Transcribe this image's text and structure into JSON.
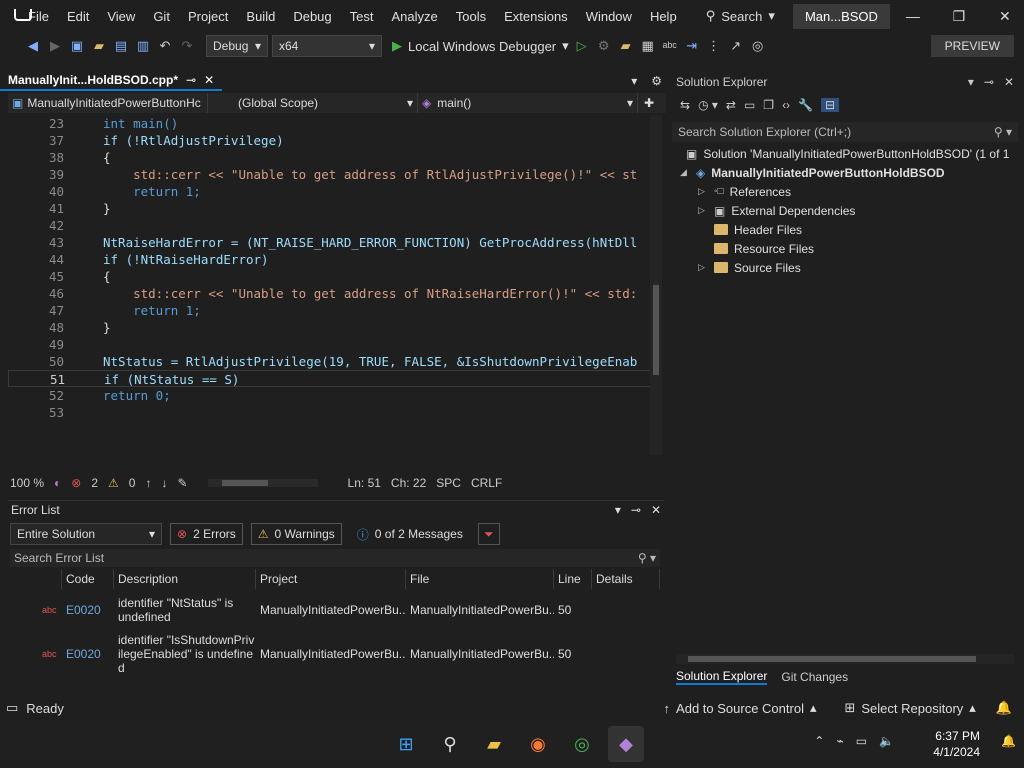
{
  "menu": {
    "items": [
      "File",
      "Edit",
      "View",
      "Git",
      "Project",
      "Build",
      "Debug",
      "Test",
      "Analyze",
      "Tools",
      "Extensions",
      "Window",
      "Help"
    ],
    "search_label": "Search",
    "project_short": "Man...BSOD"
  },
  "toolbar": {
    "config": "Debug",
    "platform": "x64",
    "run_label": "Local Windows Debugger",
    "preview_label": "PREVIEW"
  },
  "editor": {
    "tab_title": "ManuallyInit...HoldBSOD.cpp*",
    "nav_file": "ManuallyInitiatedPowerButtonHc",
    "nav_scope": "(Global Scope)",
    "nav_func": "main()",
    "lines": [
      {
        "n": "23",
        "text": "int main()"
      },
      {
        "n": "37",
        "text": "if (!RtlAdjustPrivilege)"
      },
      {
        "n": "38",
        "text": "{"
      },
      {
        "n": "39",
        "text": "    std::cerr << \"Unable to get address of RtlAdjustPrivilege()!\" << st"
      },
      {
        "n": "40",
        "text": "    return 1;"
      },
      {
        "n": "41",
        "text": "}"
      },
      {
        "n": "42",
        "text": ""
      },
      {
        "n": "43",
        "text": "NtRaiseHardError = (NT_RAISE_HARD_ERROR_FUNCTION) GetProcAddress(hNtDll"
      },
      {
        "n": "44",
        "text": "if (!NtRaiseHardError)"
      },
      {
        "n": "45",
        "text": "{"
      },
      {
        "n": "46",
        "text": "    std::cerr << \"Unable to get address of NtRaiseHardError()!\" << std:"
      },
      {
        "n": "47",
        "text": "    return 1;"
      },
      {
        "n": "48",
        "text": "}"
      },
      {
        "n": "49",
        "text": ""
      },
      {
        "n": "50",
        "text": "NtStatus = RtlAdjustPrivilege(19, TRUE, FALSE, &IsShutdownPrivilegeEnab"
      },
      {
        "n": "51",
        "text": "if (NtStatus == S)"
      },
      {
        "n": "52",
        "text": "return 0;"
      },
      {
        "n": "53",
        "text": ""
      }
    ],
    "zoom": "100 %",
    "errors_count": "2",
    "warnings_count": "0",
    "line_col": "Ln: 51",
    "ch": "Ch: 22",
    "spc": "SPC",
    "crlf": "CRLF"
  },
  "error_list": {
    "title": "Error List",
    "scope": "Entire Solution",
    "errors_btn": "2 Errors",
    "warnings_btn": "0 Warnings",
    "messages_btn": "0 of 2 Messages",
    "search_placeholder": "Search Error List",
    "columns": [
      "Code",
      "Description",
      "Project",
      "File",
      "Line",
      "Details"
    ],
    "rows": [
      {
        "code": "E0020",
        "desc": "identifier \"NtStatus\" is undefined",
        "project": "ManuallyInitiatedPowerBu...",
        "file": "ManuallyInitiatedPowerBu...",
        "line": "50"
      },
      {
        "code": "E0020",
        "desc": "identifier \"IsShutdownPrivilegeEnabled\" is undefined",
        "project": "ManuallyInitiatedPowerBu...",
        "file": "ManuallyInitiatedPowerBu...",
        "line": "50"
      }
    ]
  },
  "solution_explorer": {
    "title": "Solution Explorer",
    "search_placeholder": "Search Solution Explorer (Ctrl+;)",
    "solution": "Solution 'ManuallyInitiatedPowerButtonHoldBSOD' (1 of 1",
    "project": "ManuallyInitiatedPowerButtonHoldBSOD",
    "items": [
      "References",
      "External Dependencies",
      "Header Files",
      "Resource Files",
      "Source Files"
    ],
    "tabs": [
      "Solution Explorer",
      "Git Changes"
    ]
  },
  "status": {
    "ready": "Ready",
    "source_control": "Add to Source Control",
    "repository": "Select Repository"
  },
  "taskbar": {
    "time": "6:37 PM",
    "date": "4/1/2024"
  }
}
